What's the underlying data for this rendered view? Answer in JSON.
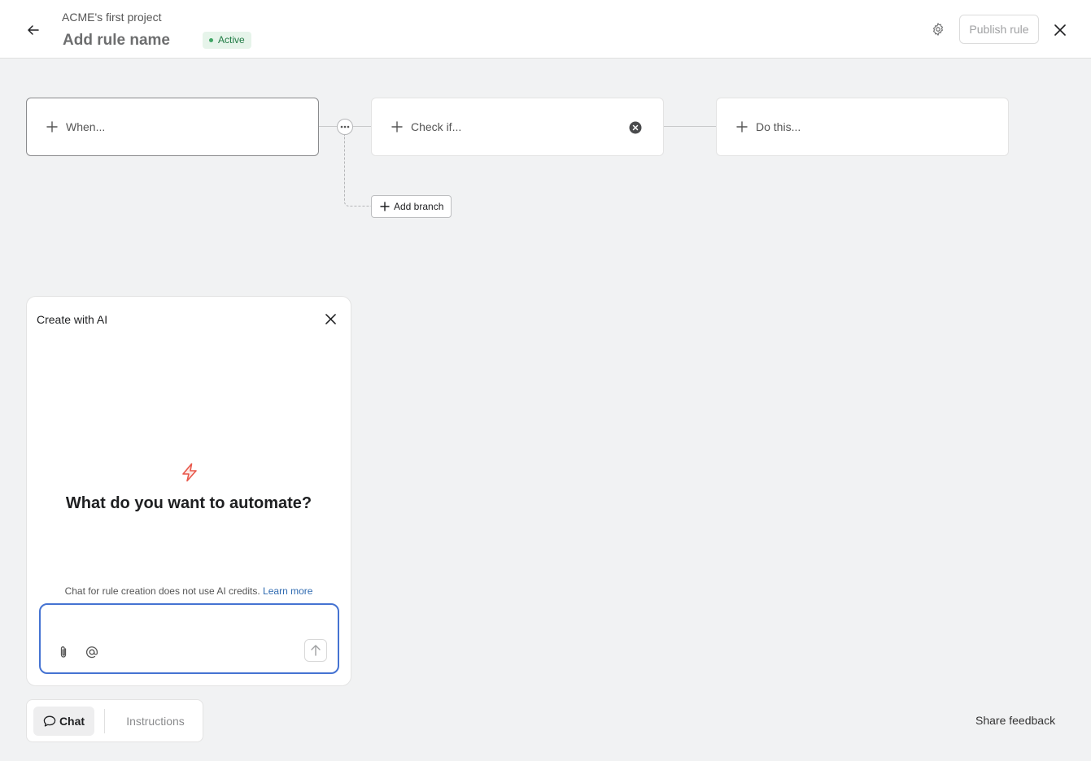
{
  "header": {
    "project_name": "ACME's first project",
    "rule_name": "Add rule name",
    "status": "Active",
    "publish_label": "Publish rule"
  },
  "flow": {
    "when_label": "When...",
    "check_label": "Check if...",
    "do_label": "Do this...",
    "add_branch_label": "Add branch"
  },
  "ai_panel": {
    "title": "Create with AI",
    "heading": "What do you want to automate?",
    "credits_note": "Chat for rule creation does not use AI credits.",
    "learn_more": "Learn more",
    "input_value": "",
    "input_placeholder": ""
  },
  "tabs": {
    "chat": "Chat",
    "instructions": "Instructions"
  },
  "footer": {
    "share_feedback": "Share feedback"
  },
  "colors": {
    "accent_blue": "#4573d2",
    "bolt_red": "#e8574a",
    "active_green": "#1f7a43",
    "canvas_bg": "#f1f2f3"
  },
  "icons": [
    "back-arrow-icon",
    "gear-icon",
    "close-icon",
    "plus-icon",
    "more-dots-icon",
    "clear-circle-icon",
    "lightning-bolt-icon",
    "paperclip-icon",
    "at-mention-icon",
    "arrow-up-icon",
    "chat-bubble-icon"
  ]
}
